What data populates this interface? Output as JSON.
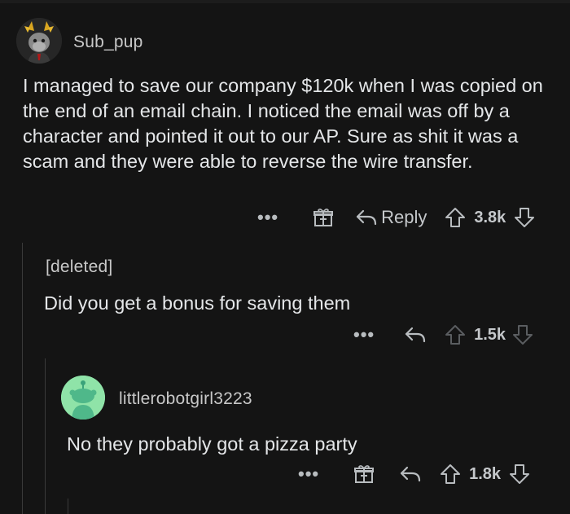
{
  "comment1": {
    "username": "Sub_pup",
    "body": "I managed to save our company $120k when I was copied on the end of an email chain. I noticed the email was off by a character and pointed it out to our AP. Sure as shit it was a scam and they were able to reverse the wire transfer.",
    "reply_label": "Reply",
    "score": "3.8k",
    "more": "•••"
  },
  "comment2": {
    "username": "[deleted]",
    "body": "Did you get a bonus for saving them",
    "score": "1.5k",
    "more": "•••"
  },
  "comment3": {
    "username": "littlerobotgirl3223",
    "body": "No they probably got a pizza party",
    "score": "1.8k",
    "more": "•••"
  },
  "colors": {
    "background": "#141414",
    "text": "#e4e6e8",
    "muted": "#b8bcbf",
    "thread_line": "#3a3a3a",
    "snoo_bg": "#8fe3a8"
  }
}
